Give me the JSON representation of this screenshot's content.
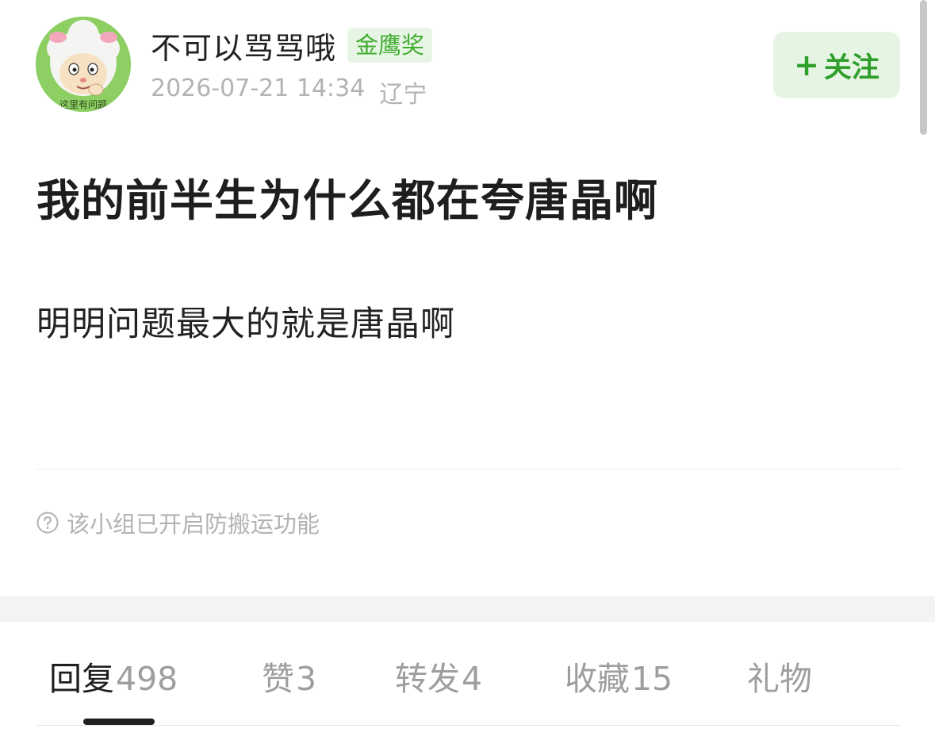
{
  "author": {
    "name": "不可以骂骂哦",
    "badge": "金鹰奖",
    "avatar_caption": "这里有问题"
  },
  "meta": {
    "timestamp": "2026-07-21 14:34",
    "location": "辽宁"
  },
  "follow": {
    "plus": "+",
    "label": "关注"
  },
  "post": {
    "title": "我的前半生为什么都在夸唐晶啊",
    "body": "明明问题最大的就是唐晶啊"
  },
  "notice": {
    "icon": "question-circle-icon",
    "text": "该小组已开启防搬运功能"
  },
  "tabs": [
    {
      "label": "回复",
      "count": "498",
      "active": true
    },
    {
      "label": "赞",
      "count": "3",
      "active": false
    },
    {
      "label": "转发",
      "count": "4",
      "active": false
    },
    {
      "label": "收藏",
      "count": "15",
      "active": false
    },
    {
      "label": "礼物",
      "count": "",
      "active": false
    }
  ],
  "colors": {
    "accent_green": "#2e9f2a",
    "badge_bg": "#e7f5e4",
    "follow_bg": "#e6f5e3",
    "muted_text": "#b3b3b3"
  }
}
